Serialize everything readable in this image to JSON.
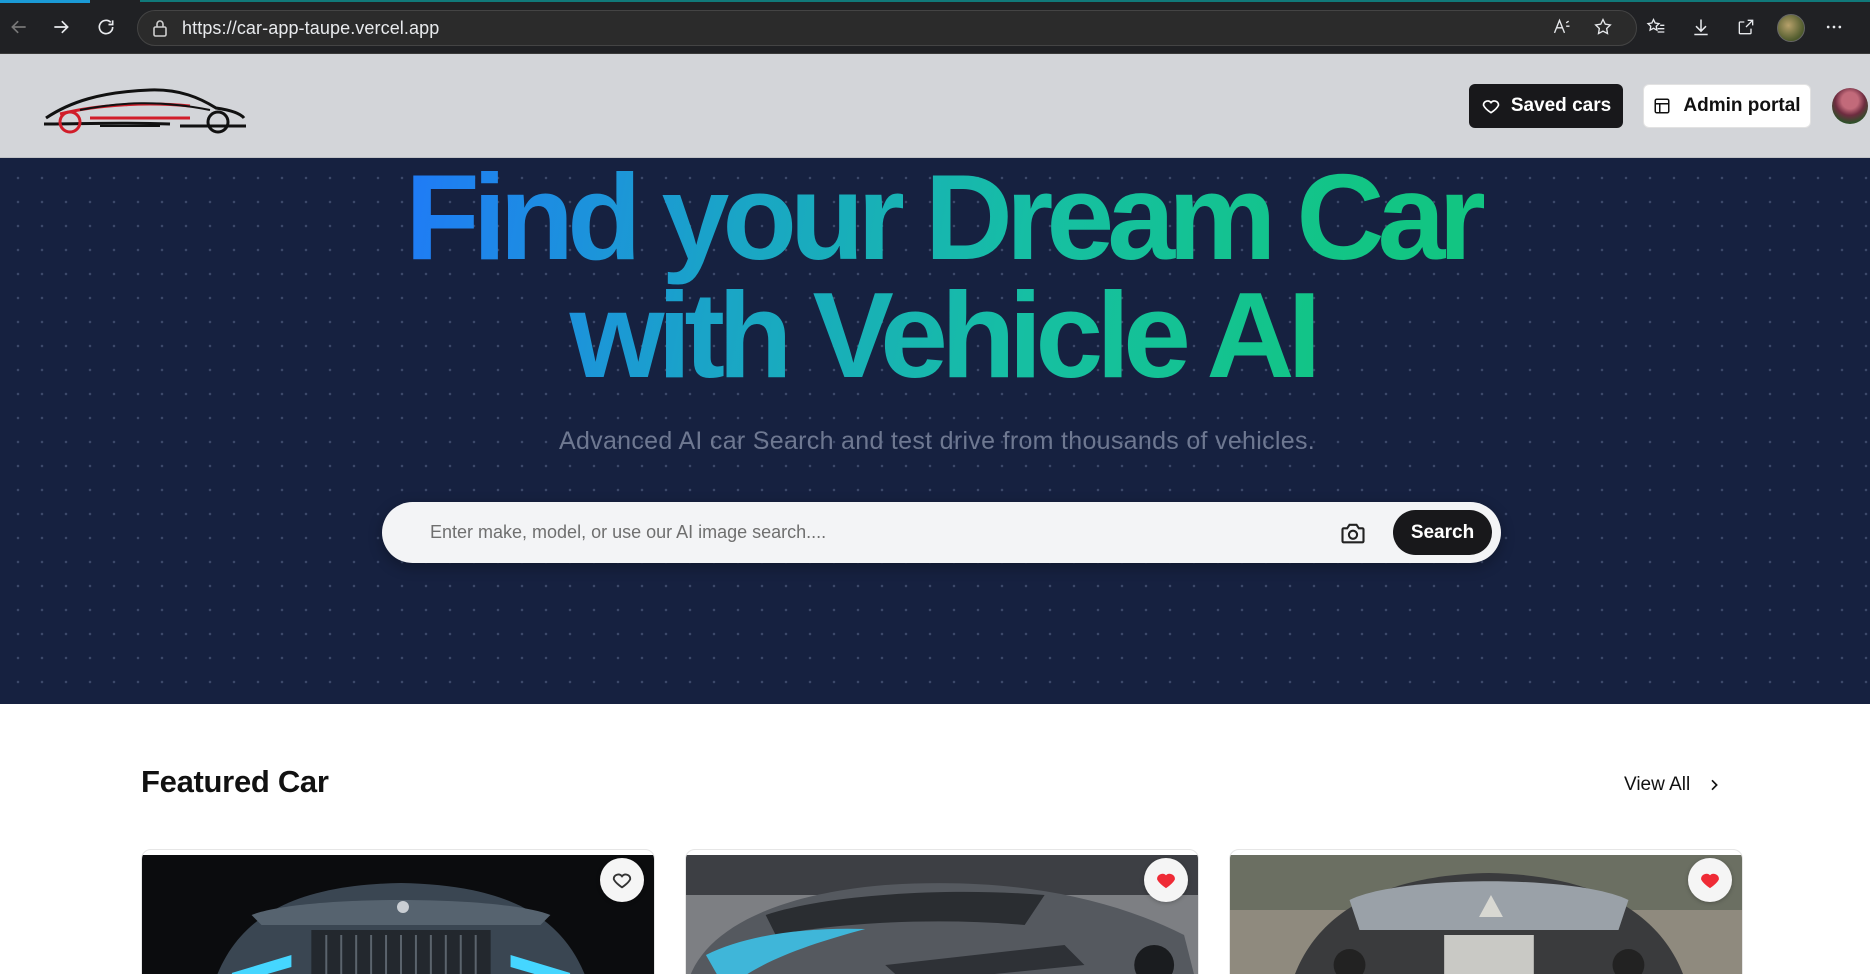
{
  "browser": {
    "url": "https://car-app-taupe.vercel.app",
    "read_aloud_label": "A"
  },
  "header": {
    "saved_cars_label": "Saved cars",
    "admin_portal_label": "Admin portal"
  },
  "hero": {
    "title_line1": "Find your Dream Car",
    "title_line2": "with Vehicle AI",
    "subtitle": "Advanced AI car Search and test drive from thousands of vehicles.",
    "search_placeholder": "Enter make, model, or use our AI image search....",
    "search_button": "Search"
  },
  "featured": {
    "title": "Featured Car",
    "view_all": "View All",
    "cards": [
      {
        "favorited": false
      },
      {
        "favorited": true
      },
      {
        "favorited": true
      }
    ]
  },
  "colors": {
    "hero_bg": "#162140",
    "gradient_start": "#1f7cf5",
    "gradient_end": "#10c57a",
    "dark_button": "#18181b",
    "favorite_red": "#ef2b36"
  }
}
